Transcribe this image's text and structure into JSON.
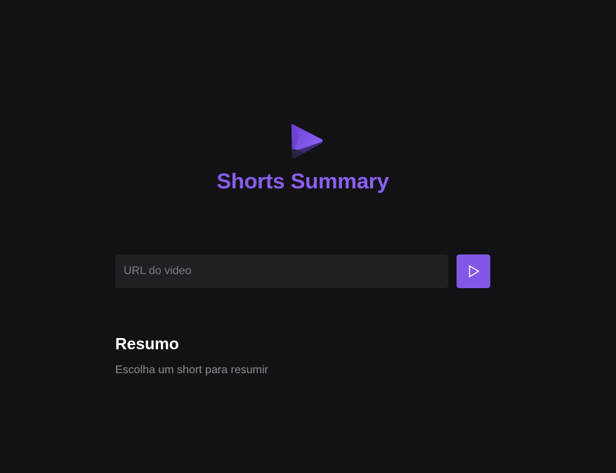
{
  "header": {
    "logo_icon": "play-triangle-logo-icon",
    "title": "Shorts Summary"
  },
  "form": {
    "url_input": {
      "value": "",
      "placeholder": "URL do video"
    },
    "submit_icon": "play-icon"
  },
  "summary": {
    "heading": "Resumo",
    "text": "Escolha um short para resumir"
  },
  "colors": {
    "background": "#121214",
    "accent": "#8257e5",
    "accent_light": "#9466ff",
    "input_background": "#202024",
    "muted_text": "#8d8d99",
    "placeholder": "#7c7c8a",
    "heading": "#ffffff"
  }
}
